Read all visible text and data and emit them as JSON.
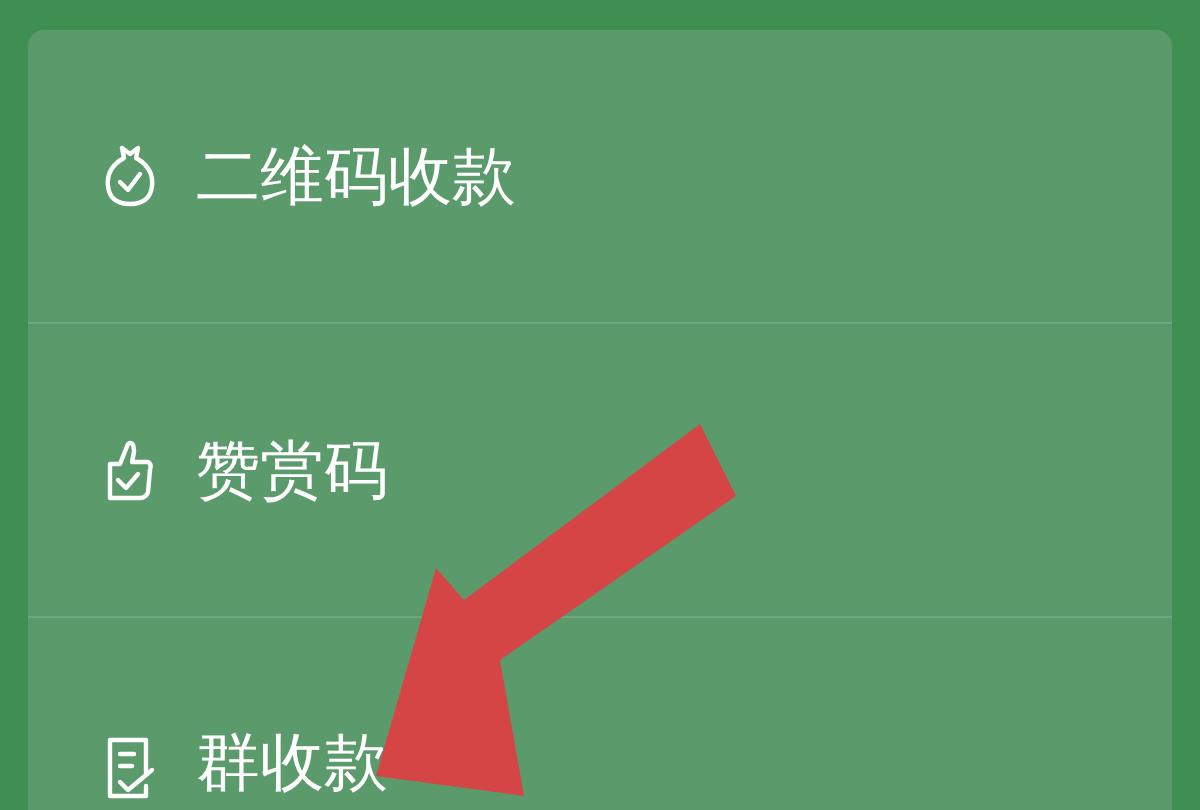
{
  "menu": {
    "items": [
      {
        "kind": "money-bag",
        "label": "二维码收款"
      },
      {
        "kind": "thumbs-up",
        "label": "赞赏码"
      },
      {
        "kind": "document",
        "label": "群收款"
      }
    ]
  },
  "annotation": {
    "kind": "arrow"
  }
}
